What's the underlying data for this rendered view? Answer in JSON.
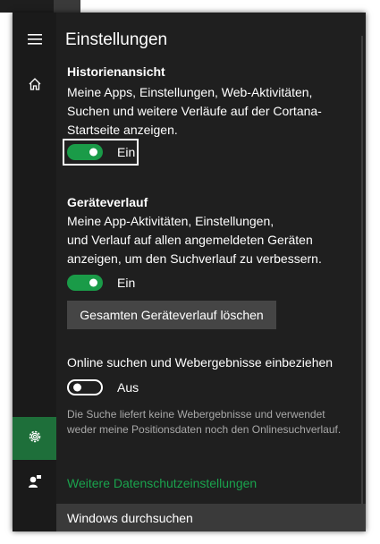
{
  "nav": {
    "menu_icon": "hamburger-icon",
    "home_icon": "home-icon",
    "settings_icon": "gear-icon",
    "feedback_icon": "feedback-icon"
  },
  "header": {
    "title": "Einstellungen"
  },
  "history_view": {
    "heading": "Historienansicht",
    "description": "Meine Apps, Einstellungen, Web-Aktivitäten, Suchen und weitere Verläufe auf der Cortana-Startseite anzeigen.",
    "toggle_state": "on",
    "toggle_label": "Ein"
  },
  "device_history": {
    "heading": "Geräteverlauf",
    "lines": [
      "Meine App-Aktivitäten, Einstellungen,",
      "und Verlauf auf allen angemeldeten Geräten",
      "anzeigen, um den Suchverlauf zu verbessern."
    ],
    "toggle_state": "on",
    "toggle_label": "Ein",
    "clear_button": "Gesamten Geräteverlauf löschen"
  },
  "web_search": {
    "heading": "Online suchen und Webergebnisse einbeziehen",
    "toggle_state": "off",
    "toggle_label": "Aus",
    "description": "Die Suche liefert keine Webergebnisse und verwendet weder meine Positionsdaten noch den Onlinesuchverlauf."
  },
  "privacy_link": "Weitere Datenschutzeinstellungen",
  "searchbar": {
    "label": "Windows durchsuchen"
  },
  "colors": {
    "accent": "#1a9b48",
    "link": "#1aa34d",
    "background": "#1f1f1f",
    "rail": "#1a1a1a",
    "active_nav": "#1e6f3a"
  }
}
